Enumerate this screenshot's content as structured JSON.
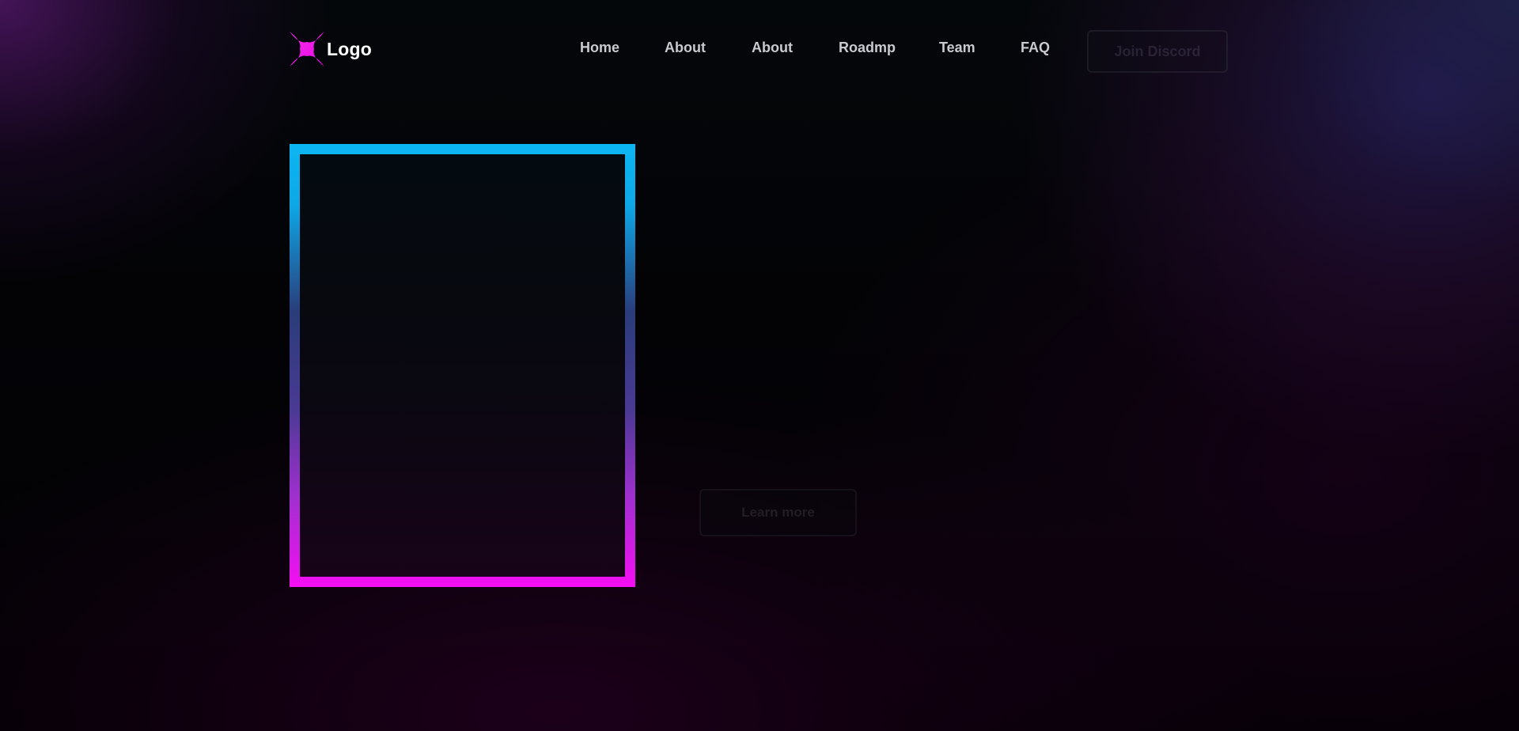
{
  "header": {
    "logo_text": "Logo",
    "logo_icon": "four-point-star-icon",
    "nav": [
      {
        "label": "Home"
      },
      {
        "label": "About"
      },
      {
        "label": "About"
      },
      {
        "label": "Roadmp"
      },
      {
        "label": "Team"
      },
      {
        "label": "FAQ"
      }
    ],
    "cta_label": "Join Discord"
  },
  "hero": {
    "cta_label": "Learn more"
  },
  "colors": {
    "brand_magenta": "#f50ef3",
    "frame_cyan": "#0bb6f2",
    "background": "#020003",
    "nav_text": "#c9c9cf"
  }
}
